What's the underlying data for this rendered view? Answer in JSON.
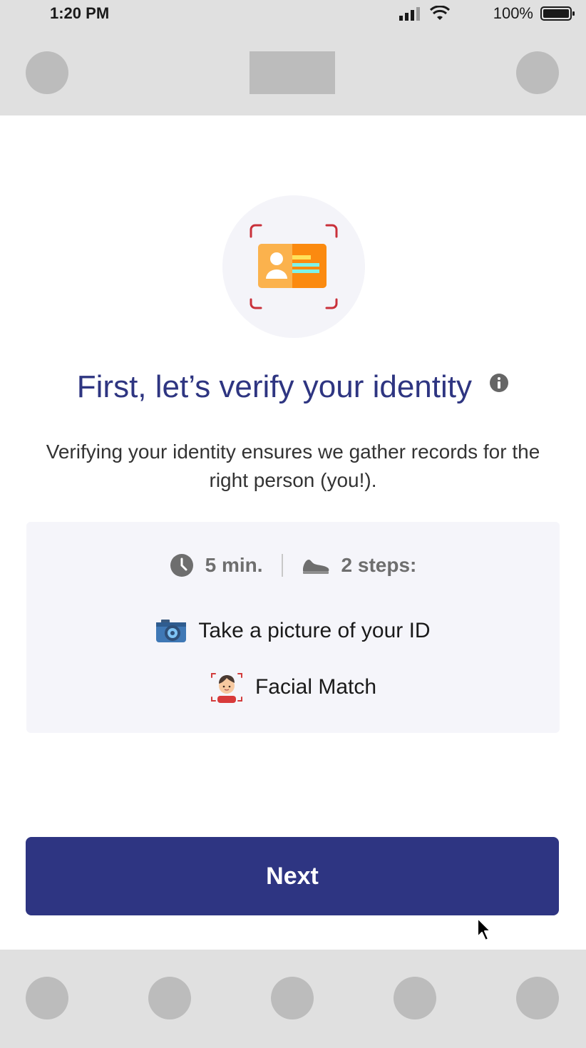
{
  "status_bar": {
    "time": "1:20 PM",
    "battery": "100%"
  },
  "hero": {
    "icon": "id-card-scan-icon"
  },
  "heading": "First, let’s verify your identity",
  "description": "Verifying your identity ensures we gather records for the right person (you!).",
  "card": {
    "duration": "5 min.",
    "steps_count": "2 steps:",
    "steps": [
      {
        "icon": "camera-icon",
        "label": "Take a picture of your ID"
      },
      {
        "icon": "face-scan-icon",
        "label": "Facial Match"
      }
    ]
  },
  "next_label": "Next",
  "colors": {
    "primary": "#2e3582",
    "heading": "#2e3581",
    "card_bg": "#f5f5fa",
    "placeholder": "#bcbcbc"
  }
}
